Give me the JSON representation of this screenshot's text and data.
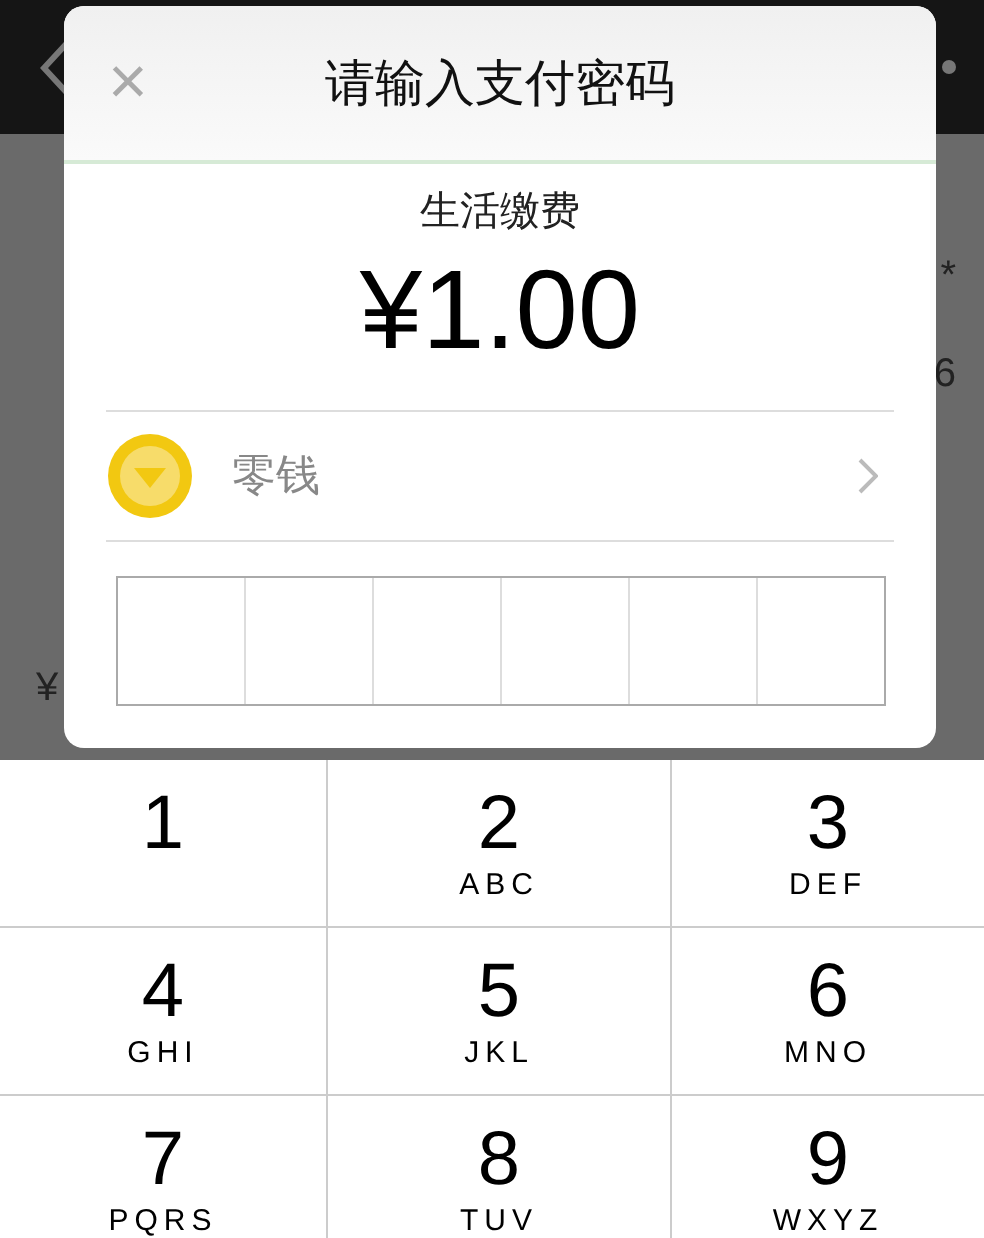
{
  "background": {
    "left_texts": [
      "¥"
    ],
    "right_texts": [
      "*",
      "6"
    ]
  },
  "dialog": {
    "title": "请输入支付密码",
    "close": "×",
    "merchant": "生活缴费",
    "amount": "¥1.00",
    "method": {
      "label": "零钱",
      "color": "#f2c811"
    }
  },
  "keypad": [
    {
      "digit": "1"
    },
    {
      "digit": "2",
      "letters": "ABC"
    },
    {
      "digit": "3",
      "letters": "DEF"
    },
    {
      "digit": "4",
      "letters": "GHI"
    },
    {
      "digit": "5",
      "letters": "JKL"
    },
    {
      "digit": "6",
      "letters": "MNO"
    },
    {
      "digit": "7",
      "letters": "PQRS"
    },
    {
      "digit": "8",
      "letters": "TUV"
    },
    {
      "digit": "9",
      "letters": "WXYZ"
    }
  ]
}
